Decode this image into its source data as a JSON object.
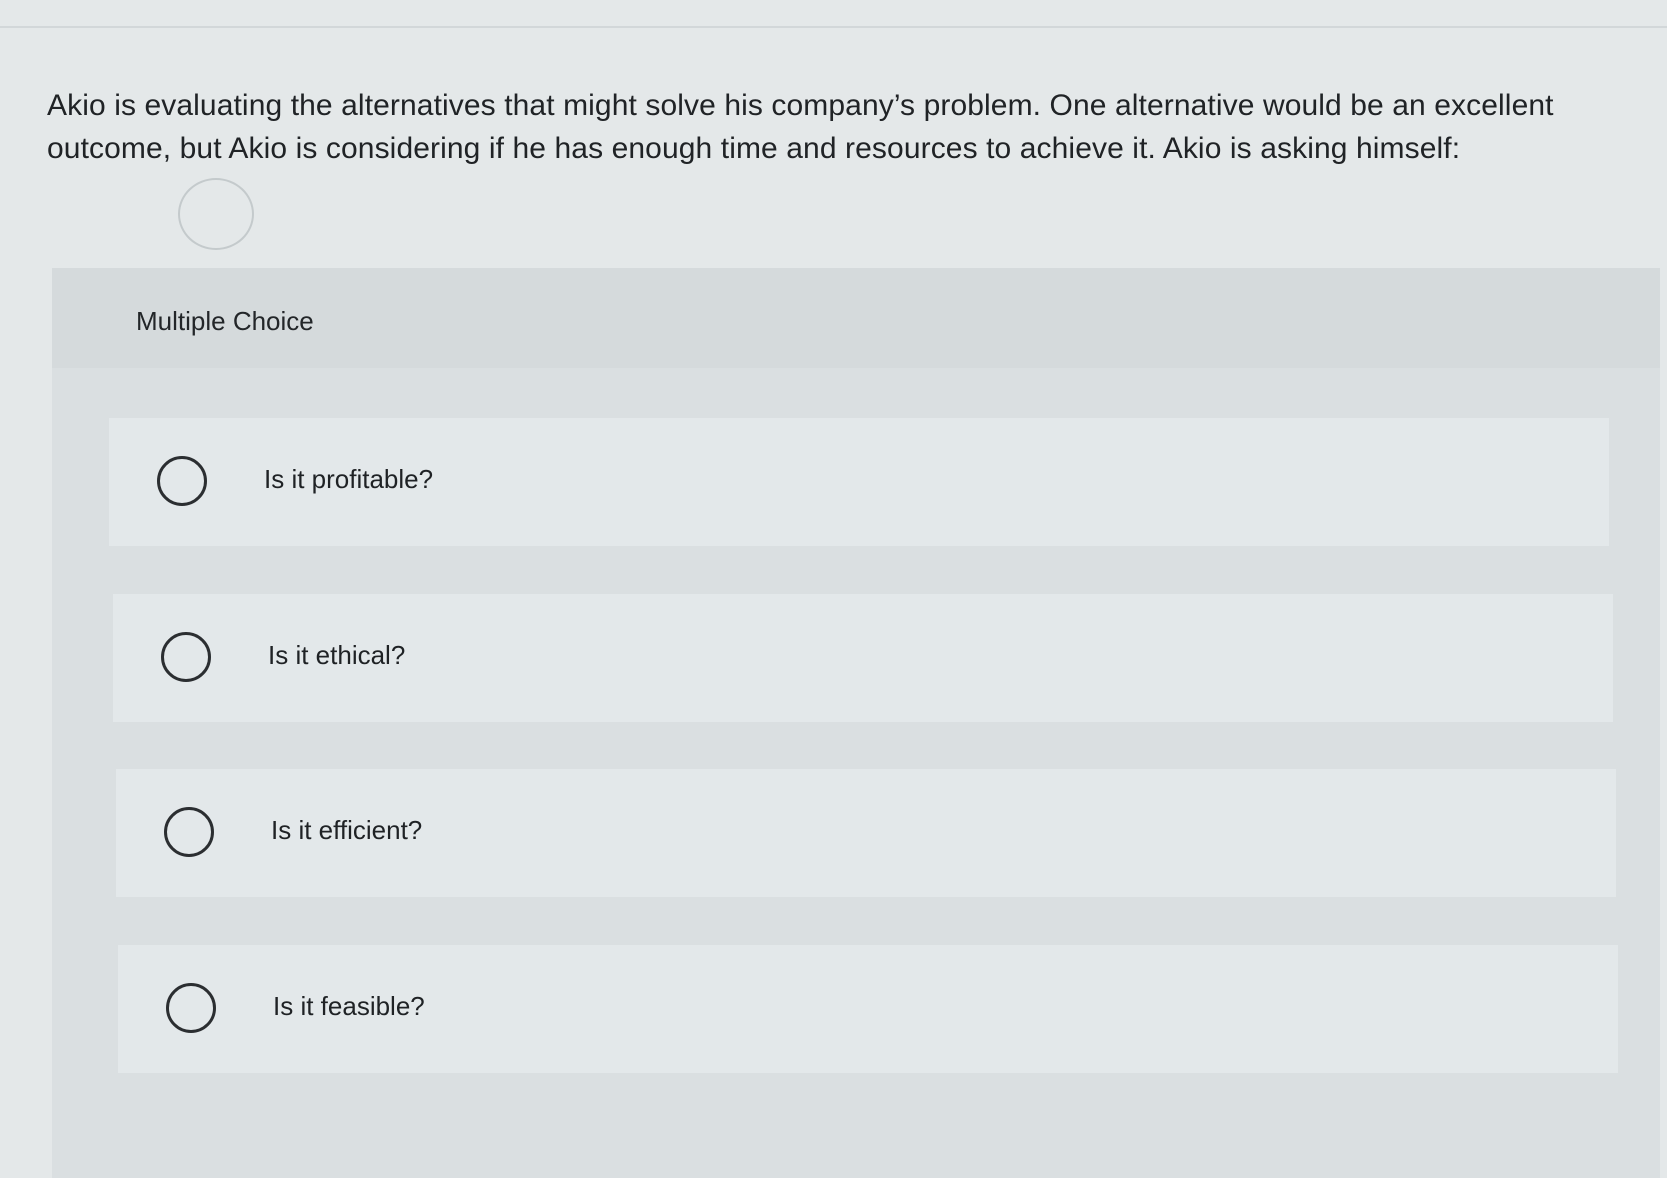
{
  "question": {
    "text": "Akio is evaluating the alternatives that might solve his company’s problem. One alternative would be an excellent outcome, but Akio is considering if he has enough time and resources to achieve it. Akio is asking himself:"
  },
  "choice_panel": {
    "title": "Multiple Choice",
    "options": [
      {
        "label": "Is it profitable?"
      },
      {
        "label": "Is it ethical?"
      },
      {
        "label": "Is it efficient?"
      },
      {
        "label": "Is it feasible?"
      }
    ]
  }
}
